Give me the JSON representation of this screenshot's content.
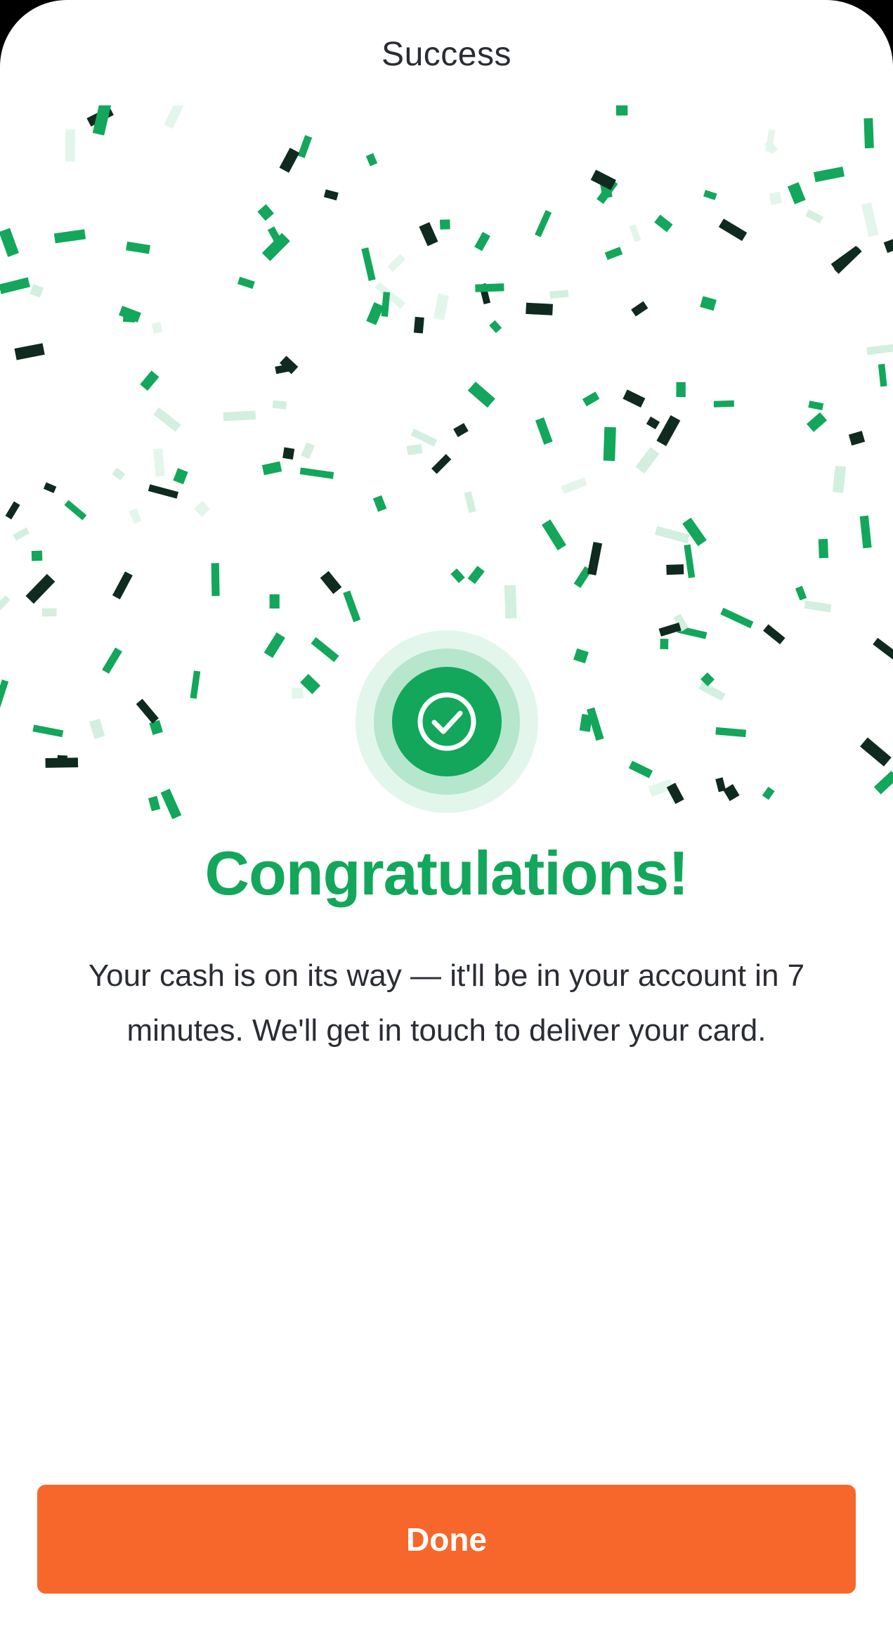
{
  "header": {
    "title": "Success"
  },
  "main": {
    "headline": "Congratulations!",
    "message": "Your cash is on its way — it'll be in your account in 7 minutes. We'll get in touch to deliver your card.",
    "success_icon": "check-circle-icon"
  },
  "footer": {
    "done_label": "Done"
  },
  "colors": {
    "accent_green": "#12a75a",
    "dark_green": "#0f2a1e",
    "button_orange": "#f7672b",
    "text": "#2a2d33"
  }
}
